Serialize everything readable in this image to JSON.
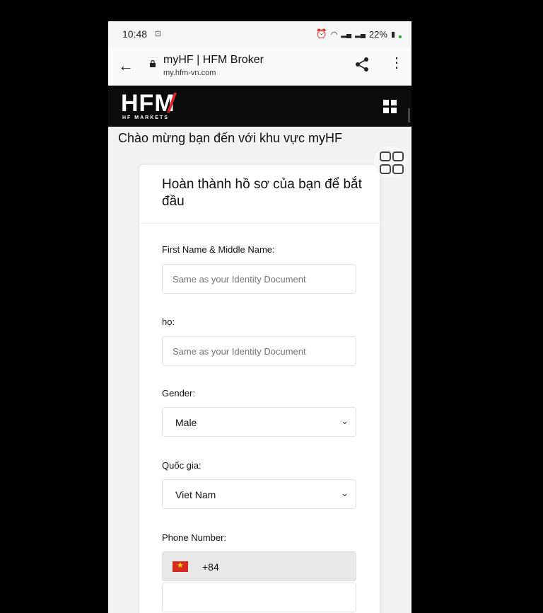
{
  "status": {
    "time": "10:48",
    "battery": "22%"
  },
  "browser": {
    "title": "myHF | HFM Broker",
    "url": "my.hfm-vn.com"
  },
  "brand": {
    "logo_text": "HFM",
    "logo_sub": "HF MARKETS"
  },
  "welcome": "Chào mừng bạn đến với khu vực myHF",
  "card": {
    "title": "Hoàn thành hồ sơ của bạn để bắt đầu",
    "fields": {
      "first_name": {
        "label": "First Name & Middle Name:",
        "placeholder": "Same as your Identity Document"
      },
      "last_name": {
        "label": "họ:",
        "placeholder": "Same as your Identity Document"
      },
      "gender": {
        "label": "Gender:",
        "value": "Male"
      },
      "country": {
        "label": "Quốc gia:",
        "value": "Viet Nam"
      },
      "phone": {
        "label": "Phone Number:",
        "code": "+84"
      }
    }
  },
  "colors": {
    "brand_bar": "#0b0b0b",
    "accent": "#d9252a"
  }
}
